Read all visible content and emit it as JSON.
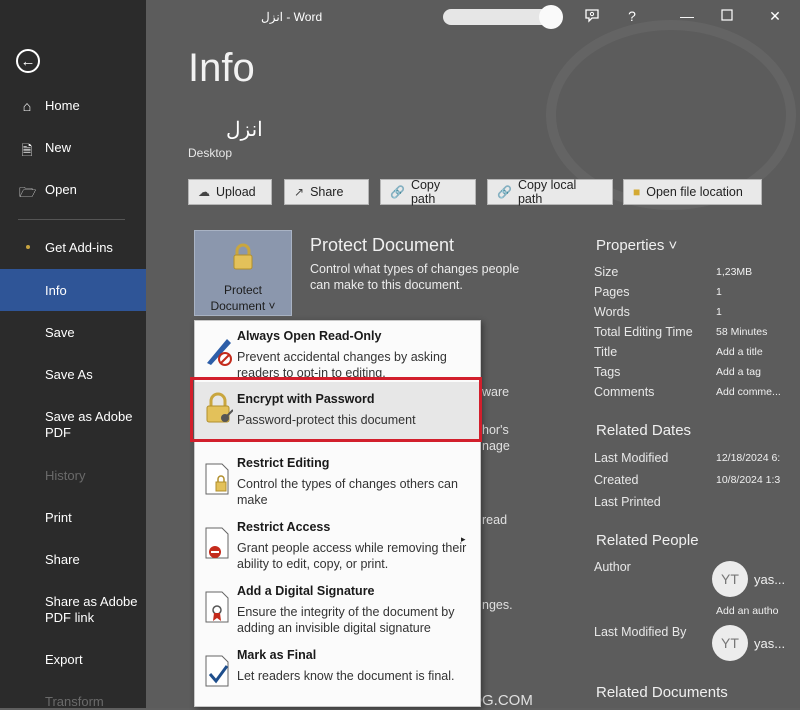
{
  "sidebar": {
    "back_icon": "back-arrow-icon",
    "items": [
      {
        "label": "Home",
        "icon": "home-icon"
      },
      {
        "label": "New",
        "icon": "new-doc-icon"
      },
      {
        "label": "Open",
        "icon": "open-folder-icon"
      },
      {
        "label": "Get Add-ins"
      },
      {
        "label": "Info"
      },
      {
        "label": "Save"
      },
      {
        "label": "Save As"
      },
      {
        "label": "Save as Adobe PDF"
      },
      {
        "label": "History"
      },
      {
        "label": "Print"
      },
      {
        "label": "Share"
      },
      {
        "label": "Share as Adobe PDF link"
      },
      {
        "label": "Export"
      },
      {
        "label": "Transform"
      }
    ],
    "active": "Info",
    "active_color": "#2f5597"
  },
  "titlebar": {
    "title": "انزل  -  Word",
    "icons": [
      "feedback-icon",
      "help-icon",
      "minimize-icon",
      "maximize-icon",
      "close-icon"
    ],
    "help": "?"
  },
  "info": {
    "heading": "Info",
    "doc_name": "انزل",
    "doc_location": "Desktop",
    "buttons": [
      {
        "label": "Upload",
        "icon": "upload-cloud-icon"
      },
      {
        "label": "Share",
        "icon": "share-icon"
      },
      {
        "label": "Copy path",
        "icon": "link-icon"
      },
      {
        "label": "Copy local path",
        "icon": "link-icon"
      },
      {
        "label": "Open file location",
        "icon": "folder-icon"
      }
    ],
    "protect": {
      "tile_line1": "Protect",
      "tile_line2": "Document ˅",
      "title": "Protect Document",
      "desc": "Control what types of changes people can make to this document."
    },
    "bg_fragments": [
      "ware",
      "hor's",
      "nage",
      "read",
      "nges.",
      "BLOG.COM"
    ]
  },
  "menu": {
    "items": [
      {
        "title": "Always Open Read-Only",
        "desc": "Prevent accidental changes by asking readers to opt-in to editing.",
        "icon": "pencil-no-icon"
      },
      {
        "title": "Encrypt with Password",
        "desc": "Password-protect this document",
        "icon": "lock-key-icon",
        "highlighted": true
      },
      {
        "title": "Restrict Editing",
        "desc": "Control the types of changes others can make",
        "icon": "doc-lock-icon"
      },
      {
        "title": "Restrict Access",
        "desc": "Grant people access while removing their ability to edit, copy, or print.",
        "icon": "doc-restrict-icon",
        "submenu": "▸"
      },
      {
        "title": "Add a Digital Signature",
        "desc": "Ensure the integrity of the document by adding an invisible digital signature",
        "icon": "doc-ribbon-icon"
      },
      {
        "title": "Mark as Final",
        "desc": "Let readers know the document is final.",
        "icon": "doc-check-icon"
      }
    ],
    "highlight_color": "#d21f2c"
  },
  "properties": {
    "heading": "Properties ˅",
    "rows": [
      {
        "k": "Size",
        "v": "1,23MB"
      },
      {
        "k": "Pages",
        "v": "1"
      },
      {
        "k": "Words",
        "v": "1"
      },
      {
        "k": "Total Editing Time",
        "v": "58 Minutes"
      },
      {
        "k": "Title",
        "v": "Add a title"
      },
      {
        "k": "Tags",
        "v": "Add a tag"
      },
      {
        "k": "Comments",
        "v": "Add comme..."
      }
    ],
    "dates_heading": "Related Dates",
    "dates": [
      {
        "k": "Last Modified",
        "v": "12/18/2024 6:"
      },
      {
        "k": "Created",
        "v": "10/8/2024 1:3"
      },
      {
        "k": "Last Printed",
        "v": ""
      }
    ],
    "people_heading": "Related People",
    "author_label": "Author",
    "author_initials": "YT",
    "author_name": "yas...",
    "add_author": "Add an autho",
    "last_modified_by_label": "Last Modified By",
    "lmb_initials": "YT",
    "lmb_name": "yas...",
    "docs_heading": "Related Documents"
  }
}
